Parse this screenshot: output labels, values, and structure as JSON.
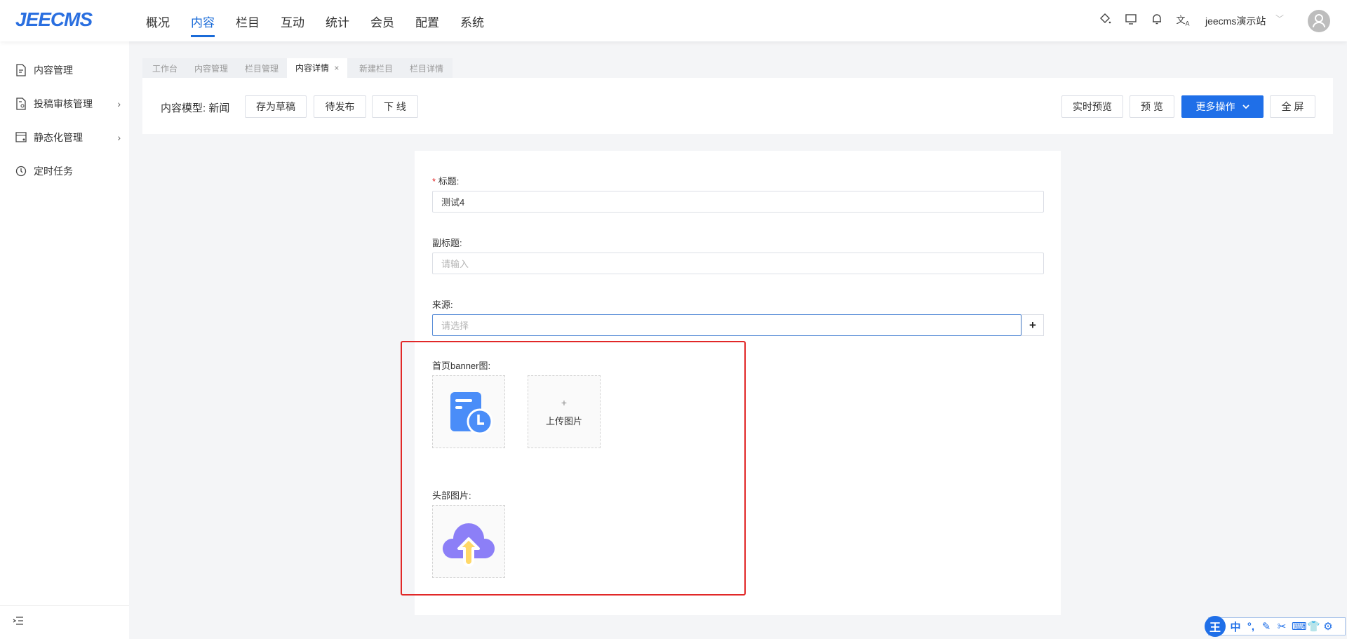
{
  "header": {
    "logo": "JEECMS",
    "nav": [
      "概况",
      "内容",
      "栏目",
      "互动",
      "统计",
      "会员",
      "配置",
      "系统"
    ],
    "active_nav": "内容",
    "site": "jeecms演示站"
  },
  "sidebar": {
    "items": [
      {
        "label": "内容管理"
      },
      {
        "label": "投稿审核管理",
        "has_children": true
      },
      {
        "label": "静态化管理",
        "has_children": true
      },
      {
        "label": "定时任务"
      }
    ]
  },
  "tabs": [
    {
      "label": "工作台"
    },
    {
      "label": "内容管理"
    },
    {
      "label": "栏目管理"
    },
    {
      "label": "内容详情",
      "active": true,
      "close": "×"
    },
    {
      "label": "新建栏目"
    },
    {
      "label": "栏目详情"
    }
  ],
  "toolbar": {
    "model_label": "内容模型:",
    "model_value": "新闻",
    "left_buttons": [
      "存为草稿",
      "待发布",
      "下 线"
    ],
    "realtime_preview": "实时预览",
    "preview": "预 览",
    "more": "更多操作",
    "fullscreen": "全 屏"
  },
  "form": {
    "title": {
      "required": "*",
      "label": "标题:",
      "value": "测试4"
    },
    "subtitle": {
      "label": "副标题:",
      "placeholder": "请输入"
    },
    "source": {
      "label": "来源:",
      "placeholder": "请选择",
      "add": "+"
    },
    "banner": {
      "label": "首页banner图:",
      "upload_plus": "+",
      "upload_label": "上传图片"
    },
    "header_image": {
      "label": "头部图片:"
    }
  },
  "ime": {
    "logo": "王",
    "items": [
      "中",
      "°,",
      "✎",
      "✂",
      "⌨",
      "👕",
      "⚙"
    ]
  },
  "colors": {
    "accent": "#1f6fe8",
    "highlight": "#e12828"
  }
}
